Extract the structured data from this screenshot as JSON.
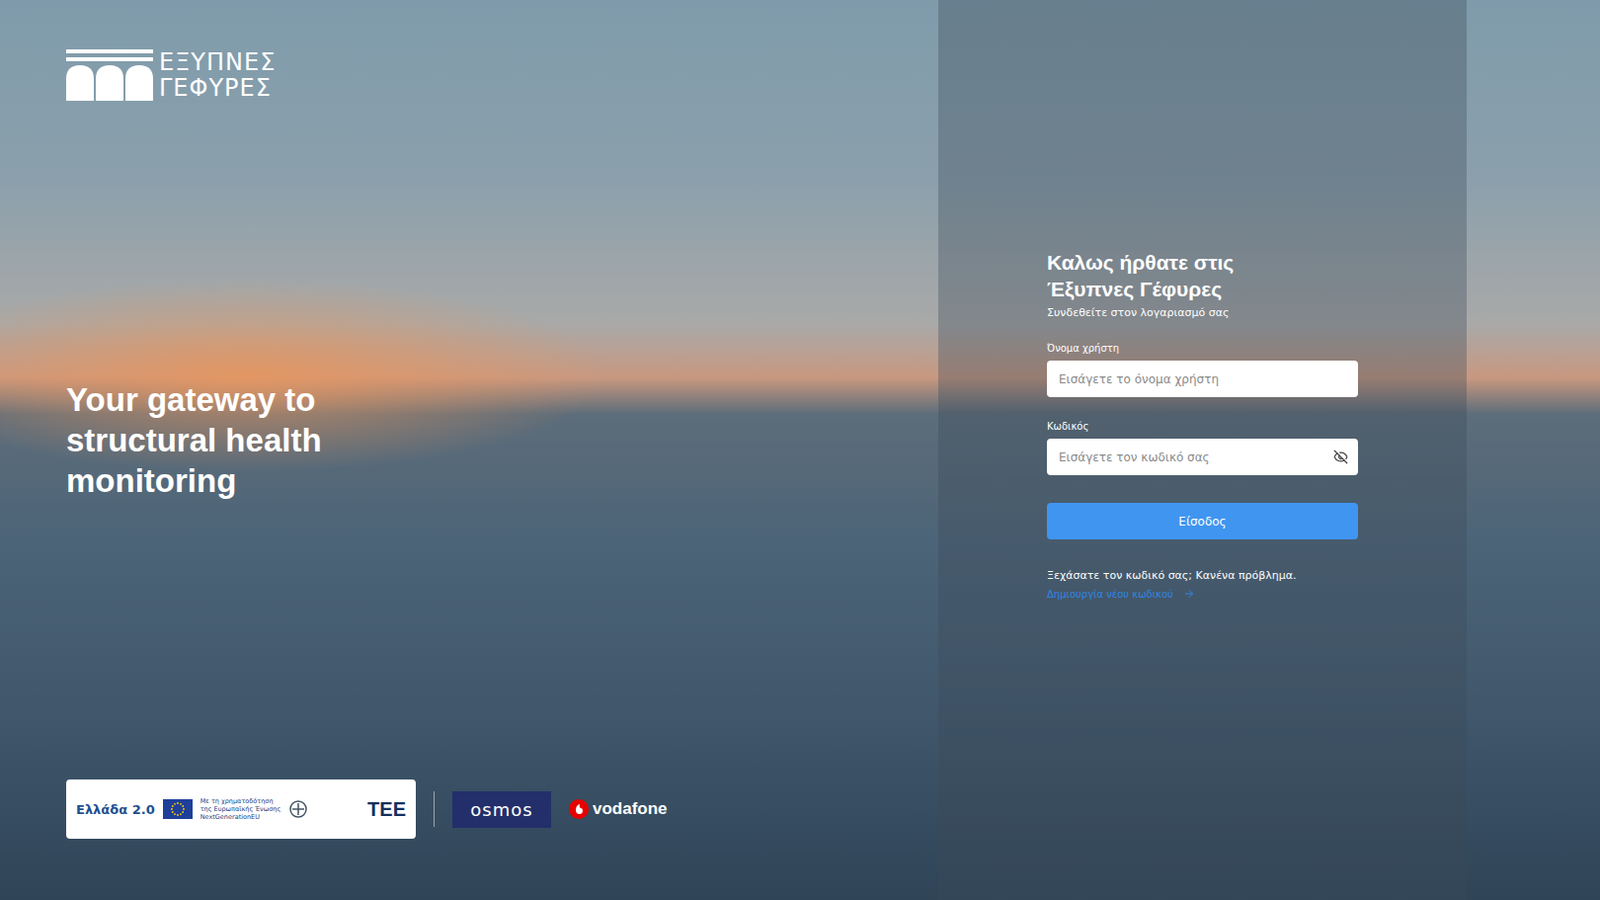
{
  "brand": {
    "logo_lines": [
      "ΕΞΥΠΝΕΣ",
      "ΓΕΦΥΡΕΣ"
    ]
  },
  "tagline_lines": [
    "Your gateway to",
    "structural health",
    "monitoring"
  ],
  "login": {
    "title_lines": [
      "Καλως ήρθατε στις",
      "Έξυπνες Γέφυρες"
    ],
    "subtitle": "Συνδεθείτε στον λογαριασμό σας",
    "fields": [
      {
        "label": "Όνομα χρήστη",
        "placeholder": "Εισάγετε το όνομα χρήστη",
        "kind": "text"
      },
      {
        "label": "Κωδικός",
        "placeholder": "Εισάγετε τον κωδικό σας",
        "kind": "password"
      }
    ],
    "submit": "Είσοδος",
    "forgot": "Ξεχάσατε τον κωδικό σας; Κανένα πρόβλημα.",
    "reset_link": "Δημιουργία νέου κωδικού"
  },
  "sponsors": {
    "greece": "Ελλάδα 2.0",
    "eu_lines": [
      "Με τη χρηματοδότηση",
      "της Ευρωπαϊκής Ένωσης"
    ],
    "eu_sub": "NextGenerationEU",
    "tee": "ΤΕΕ"
  },
  "partners": [
    "osmos",
    "vodafone"
  ]
}
